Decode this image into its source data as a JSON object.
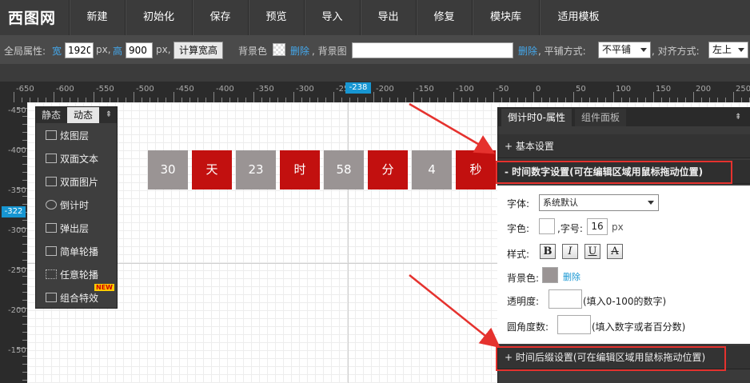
{
  "topbar": {
    "logo": "西图网",
    "menu": [
      "新建",
      "初始化",
      "保存",
      "预览",
      "导入",
      "导出",
      "修复",
      "模块库",
      "适用模板"
    ]
  },
  "propbar": {
    "global_label": "全局属性:",
    "width_label": "宽",
    "width_value": "1920",
    "px1": "px,",
    "height_label": "高",
    "height_value": "900",
    "px2": "px,",
    "calc_button": "计算宽高",
    "bgcolor_label": "背景色",
    "delete1": "删除",
    "bgimage_label": ", 背景图",
    "bgimage_value": "",
    "delete2": "删除",
    "tile_label": ", 平铺方式:",
    "tile_value": "不平铺",
    "align_label": ", 对齐方式:",
    "align_value": "左上"
  },
  "ruler": {
    "h_labels": [
      "-650",
      "-600",
      "-550",
      "-500",
      "-450",
      "-400",
      "-350",
      "-300",
      "-250",
      "-200",
      "-150",
      "-100",
      "-50",
      "0",
      "50",
      "100",
      "150",
      "200",
      "250"
    ],
    "h_marker": "-238",
    "v_labels": [
      "-450",
      "-400",
      "-350",
      "-300",
      "-250",
      "-200",
      "-150"
    ],
    "v_marker": "-322"
  },
  "toolbox": {
    "tab_static": "静态",
    "tab_dynamic": "动态",
    "collapse_icon": "⇞",
    "items": [
      "炫图层",
      "双面文本",
      "双面图片",
      "倒计时",
      "弹出层",
      "简单轮播",
      "任意轮播",
      "组合特效"
    ],
    "new_badge": "NEW"
  },
  "countdown": {
    "cells": [
      {
        "text": "30",
        "kind": "num"
      },
      {
        "text": "天",
        "kind": "unit"
      },
      {
        "text": "23",
        "kind": "num"
      },
      {
        "text": "时",
        "kind": "unit"
      },
      {
        "text": "58",
        "kind": "num"
      },
      {
        "text": "分",
        "kind": "unit"
      },
      {
        "text": "4",
        "kind": "num"
      },
      {
        "text": "秒",
        "kind": "unit"
      }
    ],
    "num_color": "#9a9494",
    "unit_color": "#c2100f"
  },
  "panel": {
    "tab_props": "倒计时0-属性",
    "tab_components": "组件面板",
    "collapse_icon": "⇞",
    "sec_basic": "+ 基本设置",
    "sec_digits": "- 时间数字设置(可在编辑区域用鼠标拖动位置)",
    "font_label": "字体:",
    "font_value": "系统默认",
    "color_label": "字色:",
    "size_label": ",字号:",
    "size_value": "16",
    "size_unit": "px",
    "style_label": "样式:",
    "style_buttons": [
      "B",
      "I",
      "U",
      "A"
    ],
    "bg_label": "背景色:",
    "bg_delete": "删除",
    "bg_color": "#9a9494",
    "opacity_label": "透明度:",
    "opacity_hint": "(填入0-100的数字)",
    "radius_label": "圆角度数:",
    "radius_hint": "(填入数字或者百分数)",
    "sec_suffix": "+ 时间后缀设置(可在编辑区域用鼠标拖动位置)"
  },
  "colors": {
    "accent": "#1796d2",
    "annotation": "#e5322e"
  }
}
